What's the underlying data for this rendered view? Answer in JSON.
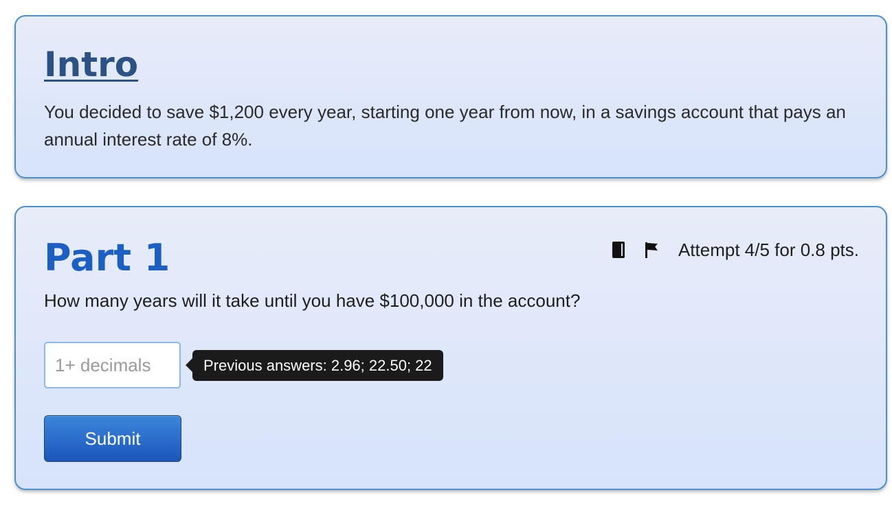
{
  "intro": {
    "title": "Intro",
    "text": "You decided to save $1,200 every year, starting one year from now, in a savings account that pays an annual interest rate of 8%."
  },
  "part1": {
    "title": "Part 1",
    "attempt": "Attempt 4/5 for 0.8 pts.",
    "question": "How many years will it take until you have $100,000 in the account?",
    "input_placeholder": "1+ decimals",
    "input_value": "",
    "previous_answers": "Previous answers: 2.96; 22.50; 22",
    "submit_label": "Submit",
    "icons": [
      "book-icon",
      "flag-icon"
    ]
  },
  "colors": {
    "card_border": "#4a8fd0",
    "intro_title": "#2c5185",
    "part_title": "#1c5fc4",
    "submit_button": "#1b56bb",
    "tooltip_bg": "#1b1b1b"
  }
}
